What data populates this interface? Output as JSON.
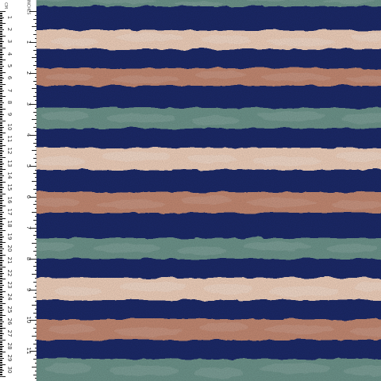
{
  "ruler": {
    "units": {
      "cm": "CM",
      "inches": "INCHES"
    },
    "cm_labels": [
      "1",
      "2",
      "3",
      "4",
      "5",
      "6",
      "7",
      "8",
      "9",
      "10",
      "11",
      "12",
      "13",
      "14",
      "15",
      "16",
      "17",
      "18",
      "19",
      "20",
      "21",
      "22",
      "23",
      "24",
      "25",
      "26",
      "27",
      "28",
      "29",
      "30"
    ],
    "inch_labels": [
      "1",
      "2",
      "3",
      "4",
      "5",
      "6",
      "7",
      "8",
      "9",
      "10",
      "11",
      "12"
    ]
  },
  "fabric": {
    "pattern": "horizontal watercolor stripes",
    "background_color": "#1e2b66",
    "stripe_colors": {
      "navy": "#1f2c6b",
      "cream": "#f2d2bd",
      "salmon": "#c58a73",
      "sage": "#6e958c"
    },
    "stripe_sequence": [
      "sage",
      "navy",
      "cream",
      "navy",
      "salmon",
      "navy",
      "sage",
      "navy",
      "cream",
      "navy",
      "salmon",
      "navy",
      "sage",
      "navy",
      "cream",
      "navy",
      "salmon",
      "navy",
      "sage"
    ]
  }
}
